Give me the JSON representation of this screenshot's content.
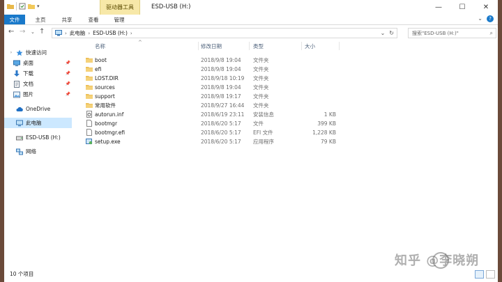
{
  "window": {
    "title": "ESD-USB (H:)",
    "context_tab": "驱动器工具",
    "controls": {
      "minimize": "—",
      "maximize": "☐",
      "close": "✕"
    }
  },
  "ribbon": {
    "tabs": [
      "文件",
      "主页",
      "共享",
      "查看",
      "管理"
    ],
    "active_tab": "文件",
    "accent_color": "#1979ca"
  },
  "address": {
    "crumbs": [
      "此电脑",
      "ESD-USB (H:)"
    ],
    "search_placeholder": "搜索\"ESD-USB (H:)\""
  },
  "nav": {
    "items": [
      {
        "label": "快速访问",
        "icon": "star-icon",
        "expander": "›",
        "indent": 0
      },
      {
        "label": "桌面",
        "icon": "desktop-icon",
        "pinned": true,
        "indent": 1
      },
      {
        "label": "下载",
        "icon": "download-icon",
        "pinned": true,
        "indent": 1
      },
      {
        "label": "文档",
        "icon": "document-icon",
        "pinned": true,
        "indent": 1
      },
      {
        "label": "图片",
        "icon": "pictures-icon",
        "pinned": true,
        "indent": 1
      },
      {
        "label": "OneDrive",
        "icon": "cloud-icon",
        "indent": 0
      },
      {
        "label": "此电脑",
        "icon": "computer-icon",
        "indent": 0,
        "selected": true
      },
      {
        "label": "ESD-USB (H:)",
        "icon": "usb-drive-icon",
        "indent": 0
      },
      {
        "label": "网络",
        "icon": "network-icon",
        "indent": 0
      }
    ]
  },
  "columns": {
    "name": "名称",
    "date": "修改日期",
    "type": "类型",
    "size": "大小"
  },
  "files": [
    {
      "name": "boot",
      "date": "2018/9/8 19:04",
      "type": "文件夹",
      "size": "",
      "icon": "folder-icon"
    },
    {
      "name": "efi",
      "date": "2018/9/8 19:04",
      "type": "文件夹",
      "size": "",
      "icon": "folder-icon"
    },
    {
      "name": "LOST.DIR",
      "date": "2018/9/18 10:19",
      "type": "文件夹",
      "size": "",
      "icon": "folder-icon"
    },
    {
      "name": "sources",
      "date": "2018/9/8 19:04",
      "type": "文件夹",
      "size": "",
      "icon": "folder-icon"
    },
    {
      "name": "support",
      "date": "2018/9/8 19:17",
      "type": "文件夹",
      "size": "",
      "icon": "folder-icon"
    },
    {
      "name": "常用软件",
      "date": "2018/9/27 16:44",
      "type": "文件夹",
      "size": "",
      "icon": "folder-icon"
    },
    {
      "name": "autorun.inf",
      "date": "2018/6/19 23:11",
      "type": "安装信息",
      "size": "1 KB",
      "icon": "settings-file-icon"
    },
    {
      "name": "bootmgr",
      "date": "2018/6/20 5:17",
      "type": "文件",
      "size": "399 KB",
      "icon": "file-icon"
    },
    {
      "name": "bootmgr.efi",
      "date": "2018/6/20 5:17",
      "type": "EFI 文件",
      "size": "1,228 KB",
      "icon": "file-icon"
    },
    {
      "name": "setup.exe",
      "date": "2018/6/20 5:17",
      "type": "应用程序",
      "size": "79 KB",
      "icon": "setup-app-icon"
    }
  ],
  "status": {
    "item_count": "10 个项目"
  },
  "watermark": "知乎 @李晓朔"
}
